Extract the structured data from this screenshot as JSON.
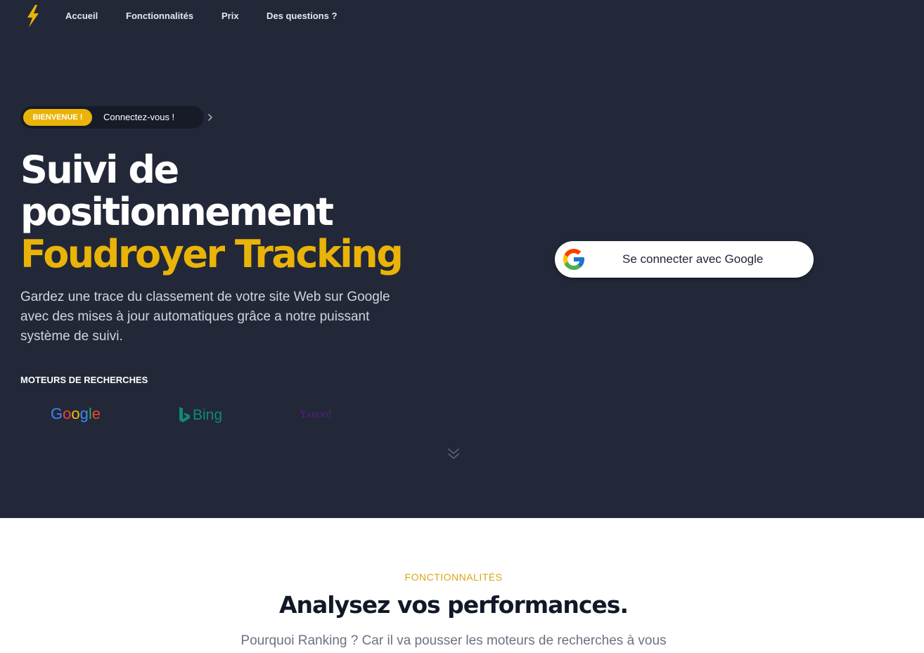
{
  "nav": {
    "links": [
      {
        "label": "Accueil"
      },
      {
        "label": "Fonctionnalités"
      },
      {
        "label": "Prix"
      },
      {
        "label": "Des questions ?"
      }
    ]
  },
  "announcement": {
    "badge": "BIENVENUE !",
    "text": "Connectez-vous !"
  },
  "hero": {
    "title_line1": "Suivi de",
    "title_line2": "positionnement",
    "title_accent": "Foudroyer Tracking",
    "subtitle": "Gardez une trace du classement de votre site Web sur Google avec des mises à jour automatiques grâce a notre puissant système de suivi.",
    "engines_title": "MOTEURS DE RECHERCHES",
    "engines": {
      "google": "Google",
      "bing": "Bing",
      "yahoo": "Yahoo!"
    }
  },
  "signin": {
    "label": "Se connecter avec Google"
  },
  "features": {
    "eyebrow": "FONCTIONNALITÉS",
    "title": "Analysez vos performances.",
    "subtitle": "Pourquoi Ranking ? Car il va pousser les moteurs de recherches à vous"
  },
  "colors": {
    "hero_bg": "#222838",
    "accent": "#eab308",
    "text_dark": "#111827"
  }
}
